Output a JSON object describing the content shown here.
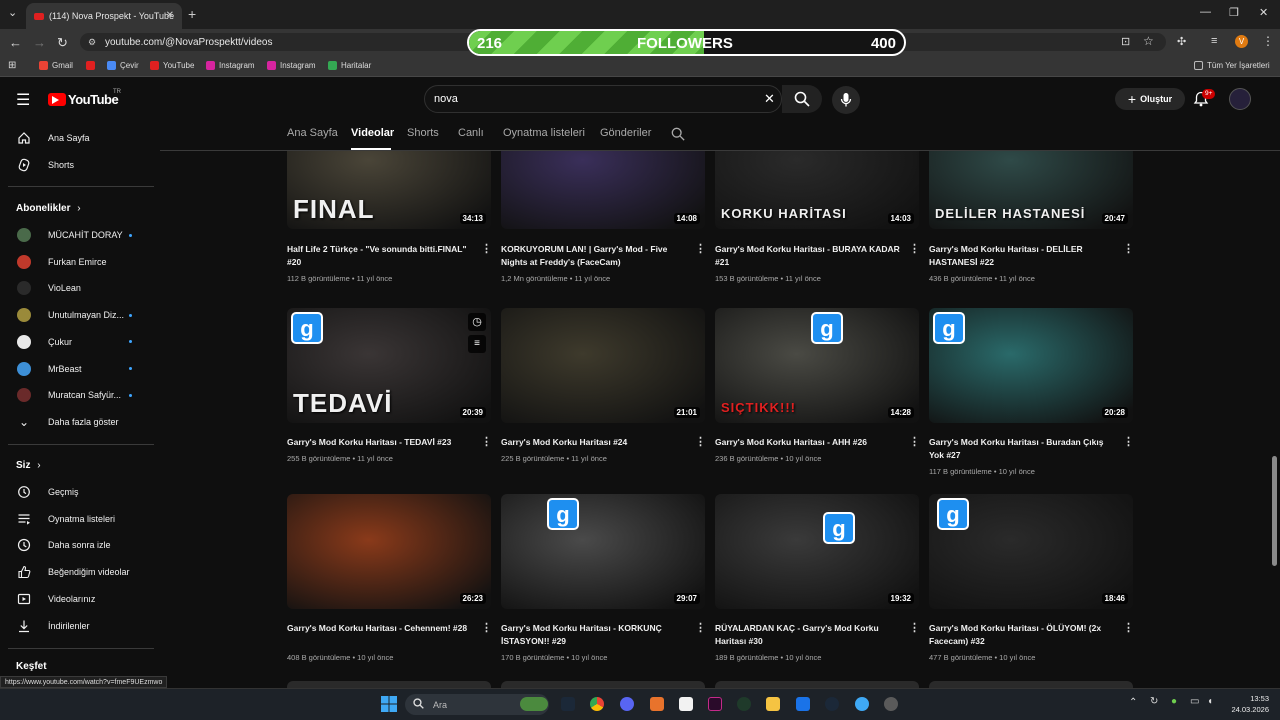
{
  "browser": {
    "tab_title": "(114) Nova Prospekt - YouTube",
    "url": "youtube.com/@NovaProspektt/videos",
    "bookmarks": [
      "Gmail",
      "Çevir",
      "YouTube",
      "Instagram",
      "Instagram",
      "Haritalar"
    ],
    "all_bookmarks": "Tüm Yer İşaretleri",
    "profile_initial": "V"
  },
  "follower_overlay": {
    "current": "216",
    "label": "FOLLOWERS",
    "goal": "400",
    "progress": 0.54
  },
  "youtube": {
    "logo": "YouTube",
    "region": "TR",
    "search_value": "nova",
    "create_label": "Oluştur",
    "notifications": "9+"
  },
  "sidebar": {
    "top": [
      {
        "label": "Ana Sayfa",
        "icon": "home-icon"
      },
      {
        "label": "Shorts",
        "icon": "shorts-icon"
      }
    ],
    "subs_heading": "Abonelikler",
    "subs": [
      {
        "label": "MÜCAHİT DORAY",
        "color": "#4a6a4a",
        "dot": true
      },
      {
        "label": "Furkan Emirce",
        "color": "#c0392b",
        "dot": false
      },
      {
        "label": "VioLean",
        "color": "#2a2a2a",
        "dot": false
      },
      {
        "label": "Unutulmayan Diz...",
        "color": "#9a8a3a",
        "dot": true
      },
      {
        "label": "Çukur",
        "color": "#e8e8e8",
        "dot": true
      },
      {
        "label": "MrBeast",
        "color": "#3d8fd6",
        "dot": true
      },
      {
        "label": "Muratcan Safyür...",
        "color": "#6a2a2a",
        "dot": true
      }
    ],
    "show_more": "Daha fazla göster",
    "you_heading": "Siz",
    "you": [
      {
        "label": "Geçmiş",
        "icon": "history-icon"
      },
      {
        "label": "Oynatma listeleri",
        "icon": "playlists-icon"
      },
      {
        "label": "Daha sonra izle",
        "icon": "watch-later-icon"
      },
      {
        "label": "Beğendiğim videolar",
        "icon": "like-icon"
      },
      {
        "label": "Videolarınız",
        "icon": "your-videos-icon"
      },
      {
        "label": "İndirilenler",
        "icon": "download-icon"
      }
    ],
    "explore_heading": "Keşfet"
  },
  "channel_tabs": [
    "Ana Sayfa",
    "Videolar",
    "Shorts",
    "Canlı",
    "Oynatma listeleri",
    "Gönderiler"
  ],
  "active_tab": "Videolar",
  "videos": [
    {
      "title": "Half Life 2 Türkçe - \"Ve sonunda bitti.FINAL\" #20",
      "meta": "112 B görüntüleme • 11 yıl önce",
      "duration": "34:13",
      "overlay": "FINAL",
      "bg": "#4a4538"
    },
    {
      "title": "KORKUYORUM LAN! | Garry's Mod - Five Nights at Freddy's (FaceCam)",
      "meta": "1,2 Mn görüntüleme • 11 yıl önce",
      "duration": "14:08",
      "overlay": "",
      "bg": "#3a2f5a"
    },
    {
      "title": "Garry's Mod Korku Haritası - BURAYA KADAR #21",
      "meta": "153 B görüntüleme • 11 yıl önce",
      "duration": "14:03",
      "overlay": "KORKU HARİTASI",
      "bg": "#2a2a2a"
    },
    {
      "title": "Garry's Mod Korku Haritası - DELİLER HASTANESİ #22",
      "meta": "436 B görüntüleme • 11 yıl önce",
      "duration": "20:47",
      "overlay": "DELİLER HASTANESİ",
      "bg": "#2f4a48"
    },
    {
      "title": "Garry's Mod Korku Haritası - TEDAVİ #23",
      "meta": "255 B görüntüleme • 11 yıl önce",
      "duration": "20:39",
      "overlay": "TEDAVİ",
      "bg": "#3a3535"
    },
    {
      "title": "Garry's Mod Korku Haritası #24",
      "meta": "225 B görüntüleme • 11 yıl önce",
      "duration": "21:01",
      "overlay": "",
      "bg": "#3e3a2c"
    },
    {
      "title": "Garry's Mod Korku Haritası - AHH #26",
      "meta": "236 B görüntüleme • 10 yıl önce",
      "duration": "14:28",
      "overlay": "SIÇTIKK!!!",
      "bg": "#4a4a44"
    },
    {
      "title": "Garry's Mod Korku Haritası - Buradan Çıkış Yok #27",
      "meta": "117 B görüntüleme • 10 yıl önce",
      "duration": "20:28",
      "overlay": "",
      "bg": "#2a6a6a"
    },
    {
      "title": "Garry's Mod Korku Haritası - Cehennem! #28",
      "meta": "408 B görüntüleme • 10 yıl önce",
      "duration": "26:23",
      "overlay": "",
      "bg": "#8a3a1a"
    },
    {
      "title": "Garry's Mod Korku Haritası - KORKUNÇ İSTASYON!! #29",
      "meta": "170 B görüntüleme • 10 yıl önce",
      "duration": "29:07",
      "overlay": "",
      "bg": "#4a4a4a"
    },
    {
      "title": "RÜYALARDAN KAÇ - Garry's Mod Korku Haritası #30",
      "meta": "189 B görüntüleme • 10 yıl önce",
      "duration": "19:32",
      "overlay": "",
      "bg": "#3a3a3a"
    },
    {
      "title": "Garry's Mod Korku Haritası - ÖLÜYOM! (2x Facecam) #32",
      "meta": "477 B görüntüleme • 10 yıl önce",
      "duration": "18:46",
      "overlay": "",
      "bg": "#2a2a2a"
    }
  ],
  "status_url": "https://www.youtube.com/watch?v=fmeF9UEzmwo",
  "taskbar": {
    "search_placeholder": "Ara",
    "time": "13:53",
    "date": "24.03.2026"
  }
}
